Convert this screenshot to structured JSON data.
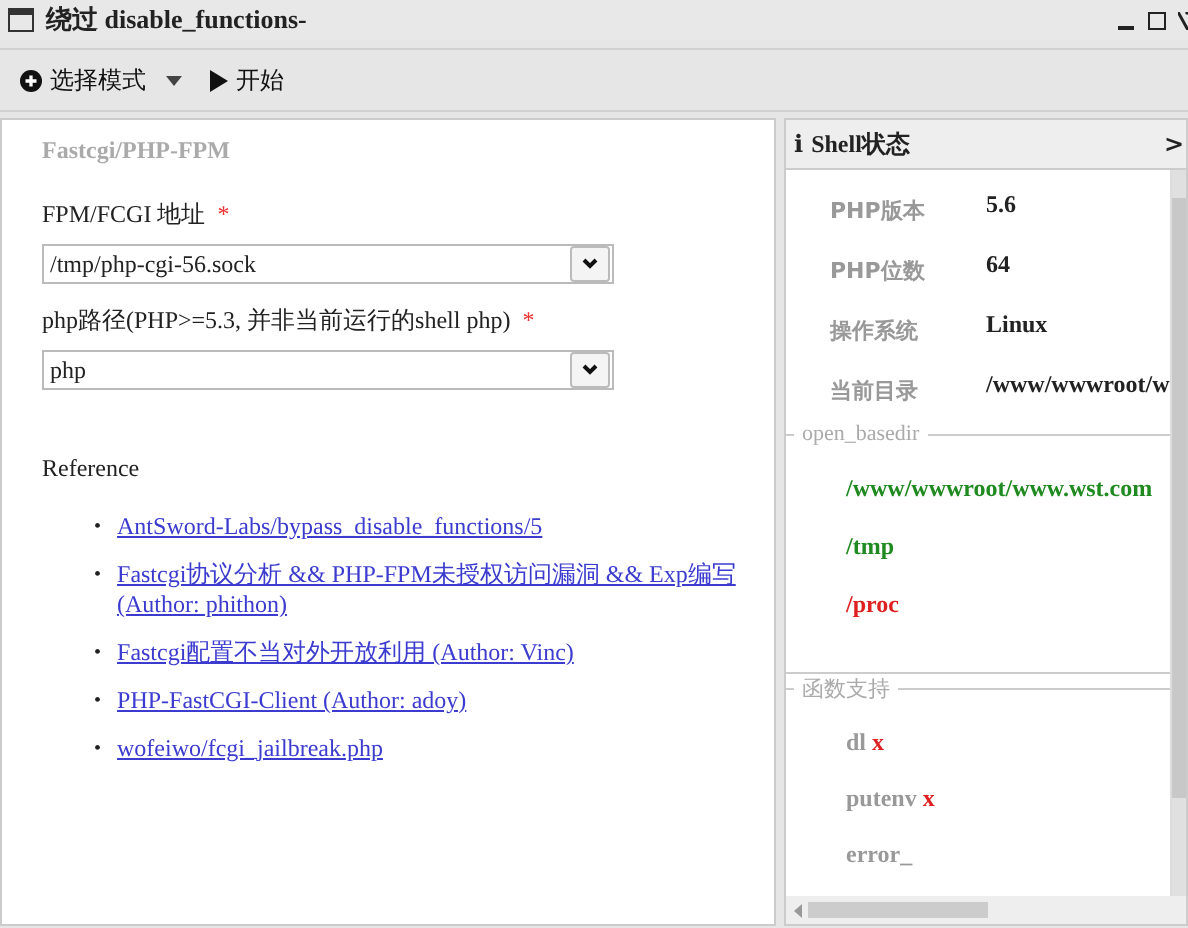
{
  "window": {
    "title": "绕过 disable_functions-"
  },
  "toolbar": [
    {
      "kind": "mode",
      "label": "选择模式"
    },
    {
      "kind": "play",
      "label": "开始"
    }
  ],
  "form": {
    "section": "Fastcgi/PHP-FPM",
    "fields": [
      {
        "label": "FPM/FCGI 地址",
        "required": true,
        "required_mark": "*",
        "value": "/tmp/php-cgi-56.sock"
      },
      {
        "label": "php路径(PHP>=5.3, 并非当前运行的shell php)",
        "required": true,
        "required_mark": "*",
        "value": "php"
      }
    ],
    "reference_title": "Reference",
    "references": [
      {
        "bullet": "•",
        "lines": [
          "AntSword-Labs/bypass_disable_functions/5"
        ]
      },
      {
        "bullet": "•",
        "lines": [
          "Fastcgi协议分析 && PHP-FPM未授权访问漏洞 && Exp编写",
          "(Author: phithon)"
        ]
      },
      {
        "bullet": "•",
        "lines": [
          "Fastcgi配置不当对外开放利用 (Author: Vinc)"
        ]
      },
      {
        "bullet": "•",
        "lines": [
          "PHP-FastCGI-Client (Author: adoy)"
        ]
      },
      {
        "bullet": "•",
        "lines": [
          "wofeiwo/fcgi_jailbreak.php"
        ]
      }
    ]
  },
  "shell_panel": {
    "icon": "i",
    "title": "Shell状态",
    "chevron": ">",
    "info": [
      {
        "label": "PHP版本",
        "value": "5.6"
      },
      {
        "label": "PHP位数",
        "value": "64"
      },
      {
        "label": "操作系统",
        "value": "Linux"
      },
      {
        "label": "当前目录",
        "value": "/www/wwwroot/w"
      }
    ],
    "open_basedir": {
      "legend": "open_basedir",
      "paths": [
        {
          "path": "/www/wwwroot/www.wst.com",
          "color": "#1f8a1f"
        },
        {
          "path": "/tmp",
          "color": "#1f8a1f"
        },
        {
          "path": "/proc",
          "color": "#e02020"
        }
      ]
    },
    "functions": {
      "legend": "函数支持",
      "items": [
        {
          "name": "dl",
          "supported": false,
          "mark": "x"
        },
        {
          "name": "putenv",
          "supported": false,
          "mark": "x"
        },
        {
          "name": "error_"
        }
      ]
    }
  }
}
